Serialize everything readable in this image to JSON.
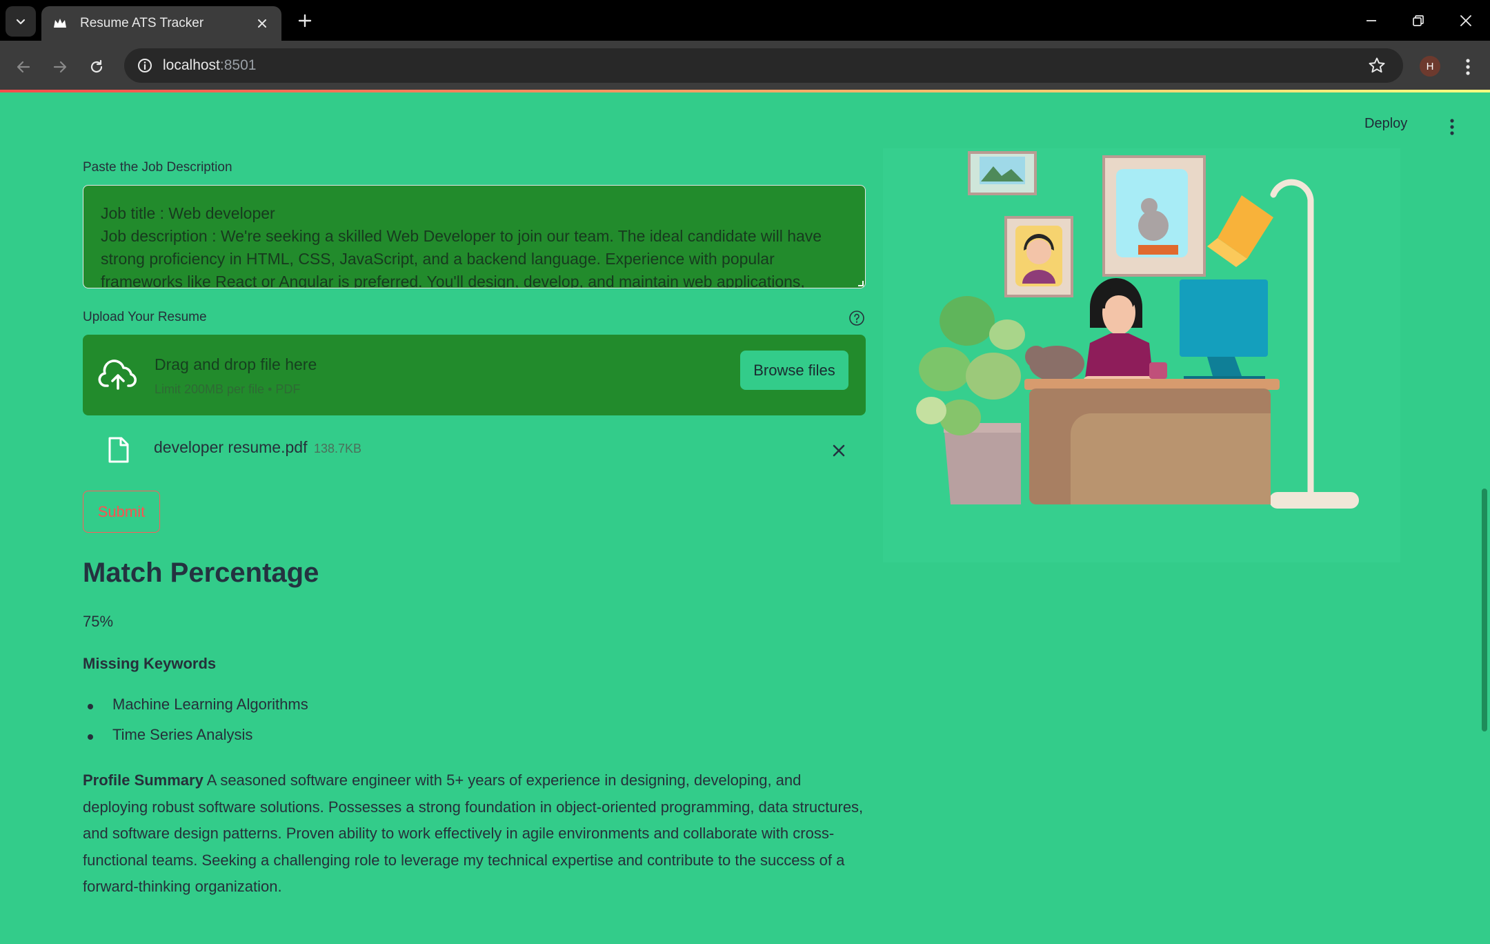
{
  "browser": {
    "tab_title": "Resume ATS Tracker",
    "url_host": "localhost",
    "url_port": ":8501",
    "profile_initial": "H",
    "icons": {
      "tab_search": "chevron-down-icon",
      "favicon": "streamlit-crown-icon",
      "close": "close-icon",
      "new_tab": "plus-icon",
      "back": "arrow-left-icon",
      "forward": "arrow-right-icon",
      "reload": "reload-icon",
      "site_info": "info-icon",
      "bookmark": "star-icon",
      "menu": "kebab-menu-icon"
    }
  },
  "header": {
    "deploy_label": "Deploy"
  },
  "form": {
    "jd_label": "Paste the Job Description",
    "jd_value": "Job title : Web developer\nJob description : We're seeking a skilled Web Developer to join our team. The ideal candidate will have strong proficiency in HTML, CSS, JavaScript, and a backend language. Experience with popular frameworks like React or Angular is preferred. You'll design, develop, and maintain web applications, collaborate with",
    "upload_label": "Upload Your Resume",
    "dropzone_title": "Drag and drop file here",
    "dropzone_limit": "Limit 200MB per file • PDF",
    "browse_label": "Browse files",
    "file_name": "developer resume.pdf",
    "file_size": "138.7KB",
    "submit_label": "Submit"
  },
  "results": {
    "heading": "Match Percentage",
    "match_value": "75%",
    "missing_title": "Missing Keywords",
    "missing_keywords": [
      "Machine Learning Algorithms",
      "Time Series Analysis"
    ],
    "summary_label": "Profile Summary",
    "summary_text": "A seasoned software engineer with 5+ years of experience in designing, developing, and deploying robust software solutions. Possesses a strong foundation in object-oriented programming, data structures, and software design patterns. Proven ability to work effectively in agile environments and collaborate with cross-functional teams. Seeking a challenging role to leverage my technical expertise and contribute to the success of a forward-thinking organization."
  },
  "colors": {
    "background": "#33cc8a",
    "input_bg": "#228b2c",
    "submit_accent": "#ff5050"
  }
}
